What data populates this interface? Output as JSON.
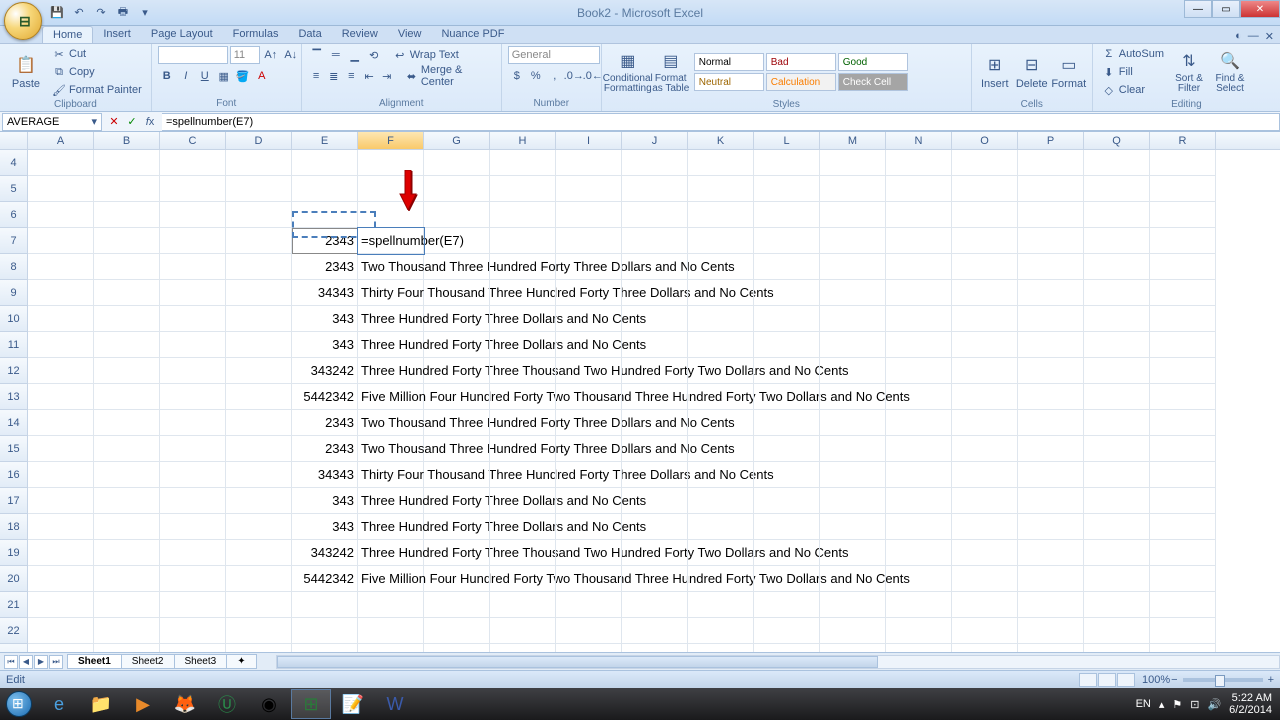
{
  "title": "Book2 - Microsoft Excel",
  "qat": [
    "save",
    "undo",
    "redo",
    "print",
    "open"
  ],
  "tabs": [
    "Home",
    "Insert",
    "Page Layout",
    "Formulas",
    "Data",
    "Review",
    "View",
    "Nuance PDF"
  ],
  "activeTab": "Home",
  "ribbon": {
    "clipboard": {
      "label": "Clipboard",
      "paste": "Paste",
      "cut": "Cut",
      "copy": "Copy",
      "fmt": "Format Painter"
    },
    "font": {
      "label": "Font",
      "name": "",
      "size": "11"
    },
    "alignment": {
      "label": "Alignment",
      "wrap": "Wrap Text",
      "merge": "Merge & Center"
    },
    "number": {
      "label": "Number",
      "fmt": "General"
    },
    "styles": {
      "label": "Styles",
      "cond": "Conditional Formatting",
      "tbl": "Format as Table",
      "cells": [
        "Normal",
        "Bad",
        "Good",
        "Neutral",
        "Calculation",
        "Check Cell"
      ]
    },
    "cells": {
      "label": "Cells",
      "ins": "Insert",
      "del": "Delete",
      "fmt": "Format"
    },
    "editing": {
      "label": "Editing",
      "sum": "AutoSum",
      "fill": "Fill",
      "clear": "Clear",
      "sort": "Sort & Filter",
      "find": "Find & Select"
    }
  },
  "namebox": "AVERAGE",
  "formula": "=spellnumber(E7)",
  "cellEditing": "=spellnumber(E7)",
  "columns": [
    "A",
    "B",
    "C",
    "D",
    "E",
    "F",
    "G",
    "H",
    "I",
    "J",
    "K",
    "L",
    "M",
    "N",
    "O",
    "P",
    "Q",
    "R"
  ],
  "selectedCol": "F",
  "firstRow": 4,
  "rowCount": 21,
  "cells": {
    "E7": "2343",
    "F7": "=spellnumber(E7)",
    "E8": "2343",
    "F8": "Two Thousand Three Hundred Forty Three Dollars and No Cents",
    "E9": "34343",
    "F9": "Thirty Four Thousand Three Hundred Forty Three Dollars and No Cents",
    "E10": "343",
    "F10": "Three Hundred Forty Three Dollars and No Cents",
    "E11": "343",
    "F11": "Three Hundred Forty Three Dollars and No Cents",
    "E12": "343242",
    "F12": "Three Hundred Forty Three Thousand Two Hundred Forty Two Dollars and No Cents",
    "E13": "5442342",
    "F13": "Five Million Four Hundred Forty Two Thousand Three Hundred Forty Two Dollars and No Cents",
    "E14": "2343",
    "F14": "Two Thousand Three Hundred Forty Three Dollars and No Cents",
    "E15": "2343",
    "F15": "Two Thousand Three Hundred Forty Three Dollars and No Cents",
    "E16": "34343",
    "F16": "Thirty Four Thousand Three Hundred Forty Three Dollars and No Cents",
    "E17": "343",
    "F17": "Three Hundred Forty Three Dollars and No Cents",
    "E18": "343",
    "F18": "Three Hundred Forty Three Dollars and No Cents",
    "E19": "343242",
    "F19": "Three Hundred Forty Three Thousand Two Hundred Forty Two Dollars and No Cents",
    "E20": "5442342",
    "F20": "Five Million Four Hundred Forty Two Thousand Three Hundred Forty Two Dollars and No Cents"
  },
  "sheets": [
    "Sheet1",
    "Sheet2",
    "Sheet3"
  ],
  "activeSheet": "Sheet1",
  "status": "Edit",
  "zoom": "100%",
  "tray": {
    "lang": "EN",
    "time": "5:22 AM",
    "date": "6/2/2014"
  },
  "taskbarIcons": [
    "ie",
    "explorer",
    "wmp",
    "firefox",
    "um",
    "chrome",
    "excel",
    "notepad",
    "word"
  ]
}
